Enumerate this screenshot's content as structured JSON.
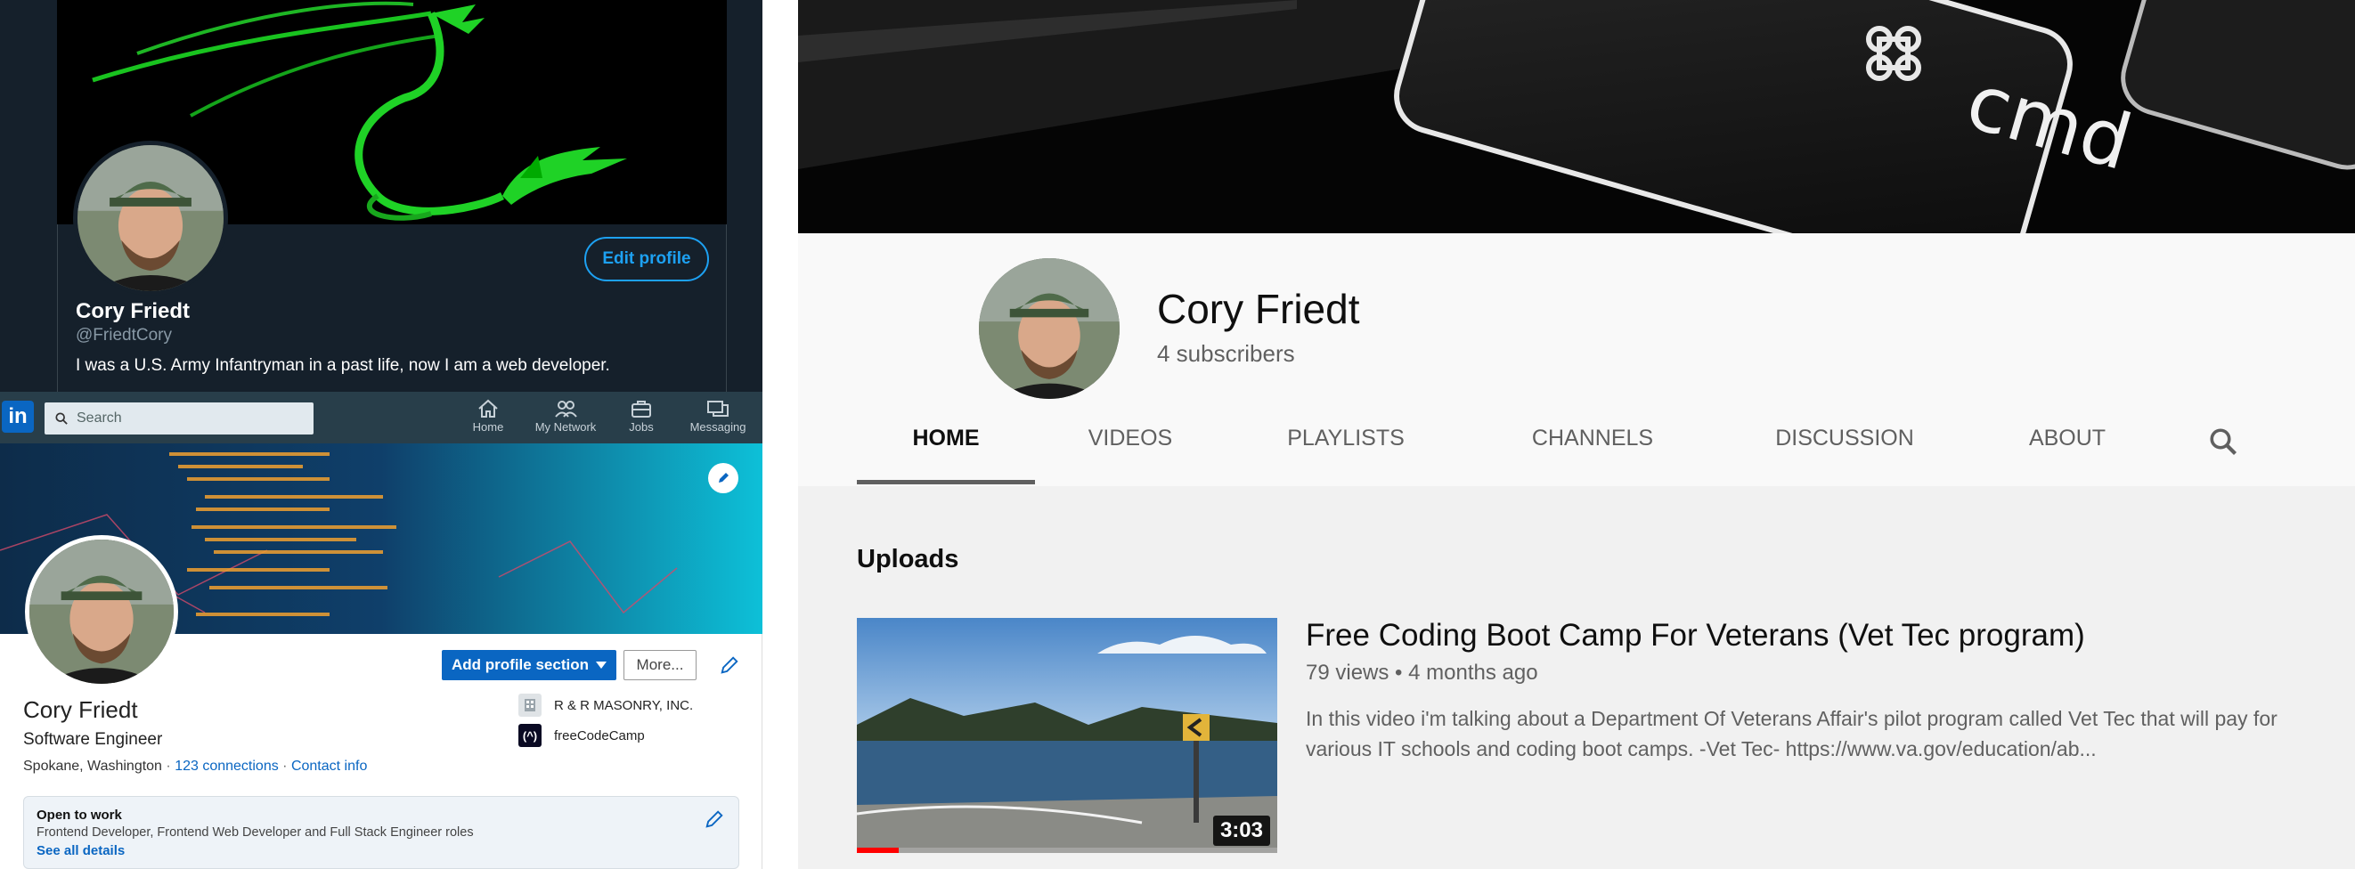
{
  "twitter": {
    "name": "Cory Friedt",
    "handle": "@FriedtCory",
    "bio": "I was a U.S. Army Infantryman in a past life, now I am a web developer.",
    "edit_profile_label": "Edit profile"
  },
  "linkedin": {
    "logo": "in",
    "search_placeholder": "Search",
    "nav": [
      {
        "label": "Home",
        "icon": "home-icon"
      },
      {
        "label": "My Network",
        "icon": "network-icon"
      },
      {
        "label": "Jobs",
        "icon": "briefcase-icon"
      },
      {
        "label": "Messaging",
        "icon": "messaging-icon"
      }
    ],
    "add_profile_section_label": "Add profile section",
    "more_label": "More...",
    "name": "Cory Friedt",
    "title": "Software Engineer",
    "location": "Spokane, Washington",
    "connections": "123 connections",
    "contact_info": "Contact info",
    "experience": [
      {
        "label": "R & R MASONRY, INC.",
        "icon": "company-icon"
      },
      {
        "label": "freeCodeCamp",
        "icon": "freecodecamp-icon"
      }
    ],
    "open_to_work": {
      "heading": "Open to work",
      "roles": "Frontend Developer, Frontend Web Developer and Full Stack Engineer roles",
      "link": "See all details"
    },
    "colors": {
      "brand": "#0a66c2",
      "nav_bg": "#283e4a"
    }
  },
  "youtube": {
    "channel_name": "Cory Friedt",
    "subscribers": "4 subscribers",
    "banner_key_text": "cmd",
    "tabs": [
      {
        "label": "HOME",
        "active": true
      },
      {
        "label": "VIDEOS",
        "active": false
      },
      {
        "label": "PLAYLISTS",
        "active": false
      },
      {
        "label": "CHANNELS",
        "active": false
      },
      {
        "label": "DISCUSSION",
        "active": false
      },
      {
        "label": "ABOUT",
        "active": false
      }
    ],
    "uploads_heading": "Uploads",
    "video": {
      "title": "Free Coding Boot Camp For Veterans (Vet Tec program)",
      "views": "79 views",
      "age": "4 months ago",
      "description": "In this video i'm talking about a Department Of Veterans Affair's pilot program called Vet Tec that will pay for various IT schools and coding boot camps. -Vet Tec- https://www.va.gov/education/ab...",
      "duration": "3:03",
      "watched_fraction": 0.1
    }
  }
}
